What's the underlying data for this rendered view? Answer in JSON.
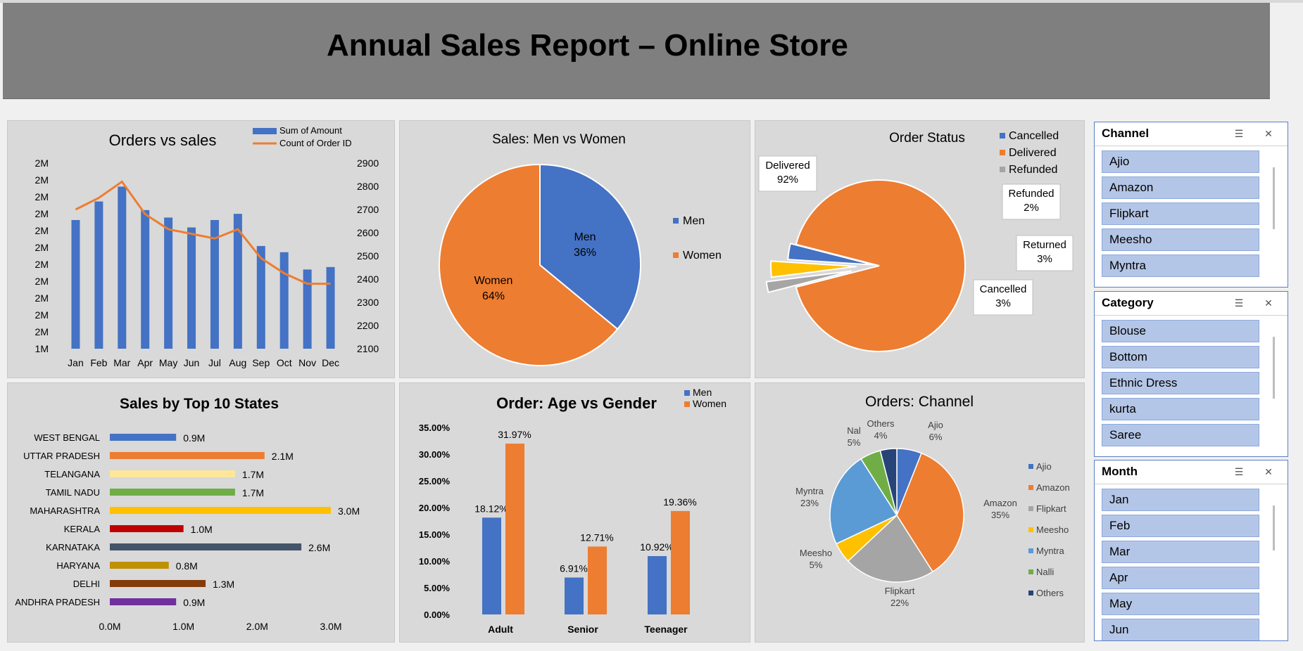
{
  "title": "Annual Sales Report – Online Store",
  "colors": {
    "blue": "#4472c4",
    "orange": "#ed7d31",
    "gray": "#a5a5a5",
    "yellow": "#ffc000",
    "lightblue": "#5b9bd5",
    "green": "#70ad47",
    "navy": "#264478"
  },
  "charts": {
    "orders_vs_sales": {
      "type": "bar+line",
      "title": "Orders vs sales",
      "categories": [
        "Jan",
        "Feb",
        "Mar",
        "Apr",
        "May",
        "Jun",
        "Jul",
        "Aug",
        "Sep",
        "Oct",
        "Nov",
        "Dec"
      ],
      "series": [
        {
          "name": "Sum of Amount",
          "type": "bar",
          "values": [
            2.04,
            2.19,
            2.31,
            2.12,
            2.06,
            1.98,
            2.04,
            2.09,
            1.83,
            1.78,
            1.64,
            1.66
          ]
        },
        {
          "name": "Count of Order ID",
          "type": "line",
          "axis": "secondary",
          "values": [
            2700,
            2750,
            2820,
            2680,
            2615,
            2595,
            2575,
            2615,
            2490,
            2425,
            2380,
            2380
          ]
        }
      ],
      "y_ticks": [
        "2M",
        "2M",
        "2M",
        "2M",
        "2M",
        "2M",
        "2M",
        "2M",
        "2M",
        "2M",
        "2M",
        "1M"
      ],
      "y2_ticks": [
        "2900",
        "2800",
        "2700",
        "2600",
        "2500",
        "2400",
        "2300",
        "2200",
        "2100"
      ],
      "ylim": [
        1.0,
        2.5
      ],
      "y2lim": [
        2100,
        2900
      ]
    },
    "men_vs_women": {
      "type": "pie",
      "title": "Sales: Men vs Women",
      "slices": [
        {
          "name": "Men",
          "value": 36,
          "label": "36%"
        },
        {
          "name": "Women",
          "value": 64,
          "label": "64%"
        }
      ],
      "legend": [
        "Men",
        "Women"
      ]
    },
    "order_status": {
      "type": "pie",
      "title": "Order Status",
      "legend": [
        "Cancelled",
        "Delivered",
        "Refunded"
      ],
      "slices": [
        {
          "name": "Delivered",
          "label": "92%",
          "value": 92
        },
        {
          "name": "Refunded",
          "label": "2%",
          "value": 2
        },
        {
          "name": "Returned",
          "label": "3%",
          "value": 3
        },
        {
          "name": "Cancelled",
          "label": "3%",
          "value": 3
        }
      ]
    },
    "top_states": {
      "type": "bar",
      "orientation": "horizontal",
      "title": "Sales by Top 10 States",
      "categories": [
        "WEST BENGAL",
        "UTTAR PRADESH",
        "TELANGANA",
        "TAMIL NADU",
        "MAHARASHTRA",
        "KERALA",
        "KARNATAKA",
        "HARYANA",
        "DELHI",
        "ANDHRA PRADESH"
      ],
      "values": [
        0.9,
        2.1,
        1.7,
        1.7,
        3.0,
        1.0,
        2.6,
        0.8,
        1.3,
        0.9
      ],
      "labels": [
        "0.9M",
        "2.1M",
        "1.7M",
        "1.7M",
        "3.0M",
        "1.0M",
        "2.6M",
        "0.8M",
        "1.3M",
        "0.9M"
      ],
      "bar_colors": [
        "#4472c4",
        "#ed7d31",
        "#ffe699",
        "#70ad47",
        "#ffc000",
        "#c00000",
        "#44546a",
        "#bf9000",
        "#843c0c",
        "#7030a0"
      ],
      "x_ticks": [
        "0.0M",
        "1.0M",
        "2.0M",
        "3.0M"
      ],
      "xlim": [
        0,
        3.0
      ]
    },
    "age_vs_gender": {
      "type": "bar",
      "title": "Order: Age vs Gender",
      "categories": [
        "Adult",
        "Senior",
        "Teenager"
      ],
      "series": [
        {
          "name": "Men",
          "values": [
            18.12,
            6.91,
            10.92
          ],
          "labels": [
            "18.12%",
            "6.91%",
            "10.92%"
          ]
        },
        {
          "name": "Women",
          "values": [
            31.97,
            12.71,
            19.36
          ],
          "labels": [
            "31.97%",
            "12.71%",
            "19.36%"
          ]
        }
      ],
      "y_ticks": [
        "35.00%",
        "30.00%",
        "25.00%",
        "20.00%",
        "15.00%",
        "10.00%",
        "5.00%",
        "0.00%"
      ],
      "ylim": [
        0,
        35
      ]
    },
    "orders_channel": {
      "type": "pie",
      "title": "Orders: Channel",
      "slices": [
        {
          "name": "Ajio",
          "value": 6,
          "label": "Ajio\n6%"
        },
        {
          "name": "Amazon",
          "value": 35,
          "label": "Amazon\n35%"
        },
        {
          "name": "Flipkart",
          "value": 22,
          "label": "Flipkart\n22%"
        },
        {
          "name": "Meesho",
          "value": 5,
          "label": "Meesho\n5%"
        },
        {
          "name": "Myntra",
          "value": 23,
          "label": "Myntra\n23%"
        },
        {
          "name": "Nalli",
          "value": 5,
          "label": "Nal\n5%"
        },
        {
          "name": "Others",
          "value": 4,
          "label": "Others\n4%"
        }
      ],
      "legend": [
        "Ajio",
        "Amazon",
        "Flipkart",
        "Meesho",
        "Myntra",
        "Nalli",
        "Others"
      ]
    }
  },
  "slicers": [
    {
      "title": "Channel",
      "items": [
        "Ajio",
        "Amazon",
        "Flipkart",
        "Meesho",
        "Myntra"
      ]
    },
    {
      "title": "Category",
      "items": [
        "Blouse",
        "Bottom",
        "Ethnic Dress",
        "kurta",
        "Saree"
      ]
    },
    {
      "title": "Month",
      "items": [
        "Jan",
        "Feb",
        "Mar",
        "Apr",
        "May",
        "Jun"
      ]
    }
  ]
}
